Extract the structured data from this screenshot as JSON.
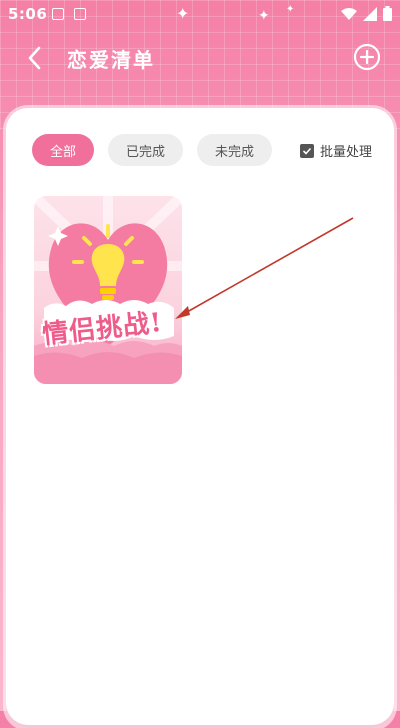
{
  "status_bar": {
    "time": "5:06"
  },
  "header": {
    "title": "恋爱清单"
  },
  "filters": [
    {
      "label": "全部",
      "active": true
    },
    {
      "label": "已完成",
      "active": false
    },
    {
      "label": "未完成",
      "active": false
    }
  ],
  "batch": {
    "label": "批量处理",
    "checked": true
  },
  "cards": [
    {
      "label": "情侣挑战!"
    }
  ],
  "colors": {
    "accent": "#f0709b",
    "header_bg": "#f57fa6",
    "arrow": "#c0392b"
  }
}
